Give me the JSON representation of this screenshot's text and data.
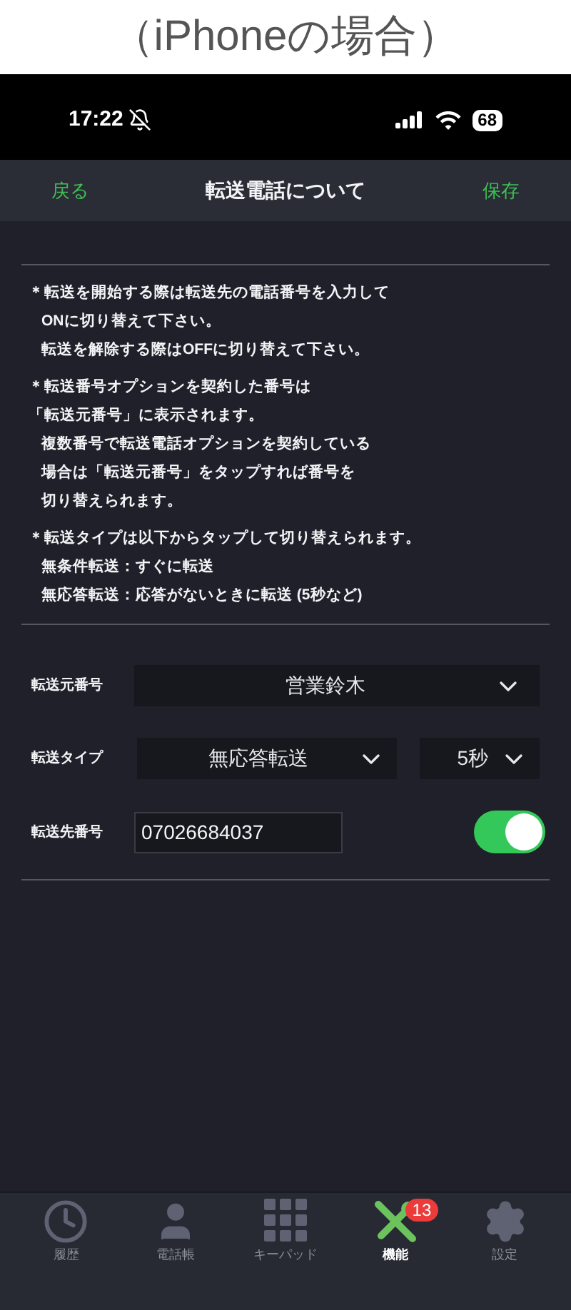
{
  "caption": "（iPhoneの場合）",
  "status_bar": {
    "time": "17:22",
    "battery": "68"
  },
  "nav": {
    "back": "戻る",
    "title": "転送電話について",
    "save": "保存"
  },
  "notes": [
    {
      "lines": [
        {
          "text": "＊転送を開始する際は転送先の電話番号を入力して",
          "indented": false
        },
        {
          "text": "ONに切り替えて下さい。",
          "indented": true
        },
        {
          "text": "転送を解除する際はOFFに切り替えて下さい。",
          "indented": true
        }
      ]
    },
    {
      "lines": [
        {
          "text": "＊転送番号オプションを契約した番号は",
          "indented": false
        },
        {
          "text": "「転送元番号」に表示されます。",
          "indented": false
        },
        {
          "text": "複数番号で転送電話オプションを契約している",
          "indented": true
        },
        {
          "text": "場合は「転送元番号」をタップすれば番号を",
          "indented": true
        },
        {
          "text": "切り替えられます。",
          "indented": true
        }
      ]
    },
    {
      "lines": [
        {
          "text": "＊転送タイプは以下からタップして切り替えられます。",
          "indented": false
        },
        {
          "text": "無条件転送：すぐに転送",
          "indented": true
        },
        {
          "text": "無応答転送：応答がないときに転送 (5秒など)",
          "indented": true
        }
      ]
    }
  ],
  "form": {
    "source_label": "転送元番号",
    "source_value": "営業鈴木",
    "type_label": "転送タイプ",
    "type_value": "無応答転送",
    "delay_value": "5秒",
    "dest_label": "転送先番号",
    "dest_value": "07026684037",
    "forwarding_on": true
  },
  "tabs": [
    {
      "kind": "history",
      "label": "履歴",
      "selected": false
    },
    {
      "kind": "contacts",
      "label": "電話帳",
      "selected": false
    },
    {
      "kind": "keypad",
      "label": "キーパッド",
      "selected": false
    },
    {
      "kind": "features",
      "label": "機能",
      "selected": true,
      "badge": "13"
    },
    {
      "kind": "settings",
      "label": "設定",
      "selected": false
    }
  ]
}
